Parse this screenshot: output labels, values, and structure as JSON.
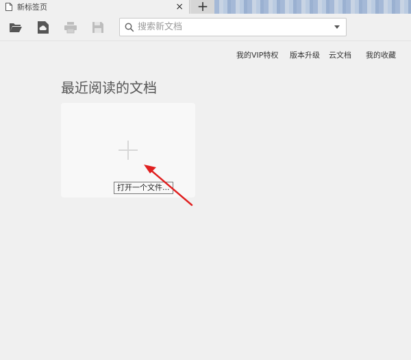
{
  "tab": {
    "title": "新标签页",
    "close_glyph": "×",
    "new_tab_glyph": "+"
  },
  "toolbar": {
    "icons": [
      "folder-open-icon",
      "cloud-upload-icon",
      "print-icon",
      "save-icon"
    ]
  },
  "search": {
    "placeholder": "搜索新文档",
    "value": ""
  },
  "top_links": [
    "我的VIP特权",
    "版本升级",
    "云文档",
    "我的收藏"
  ],
  "recent": {
    "title": "最近阅读的文档",
    "open_tooltip": "打开一个文件..."
  },
  "colors": {
    "background": "#f0f0f0",
    "card": "#f8f8f8",
    "annotation_arrow": "#e02020"
  }
}
